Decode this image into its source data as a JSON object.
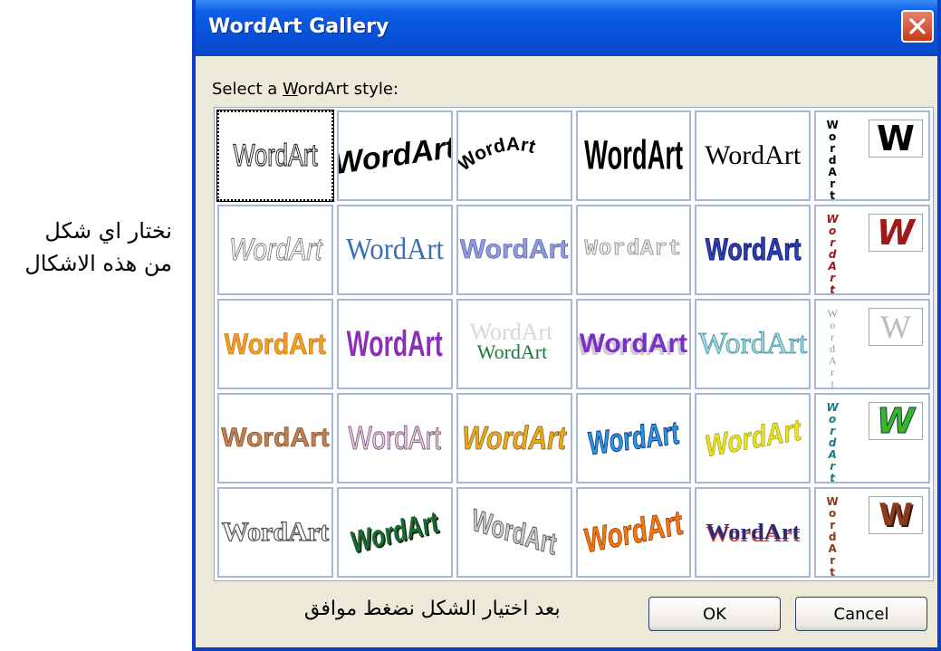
{
  "dialog": {
    "title": "WordArt Gallery",
    "select_label_before": "Select a ",
    "select_label_mnemonic": "W",
    "select_label_after": "ordArt style:",
    "ok_label": "OK",
    "cancel_label": "Cancel",
    "footer_note": "بعد اختيار الشكل نضغط موافق"
  },
  "annotation": {
    "line1": "نختار اي شكل",
    "line2": "من هذه الاشكال"
  },
  "gallery": {
    "sample_text": "WordArt",
    "vertical_letters": [
      "W",
      "o",
      "r",
      "d",
      "A",
      "r",
      "t"
    ],
    "w_glyph": "W",
    "selected_index": 0
  },
  "colors": {
    "title_bar": "#0852d9",
    "close_button": "#c63a18",
    "dialog_bg": "#ece9d8"
  }
}
